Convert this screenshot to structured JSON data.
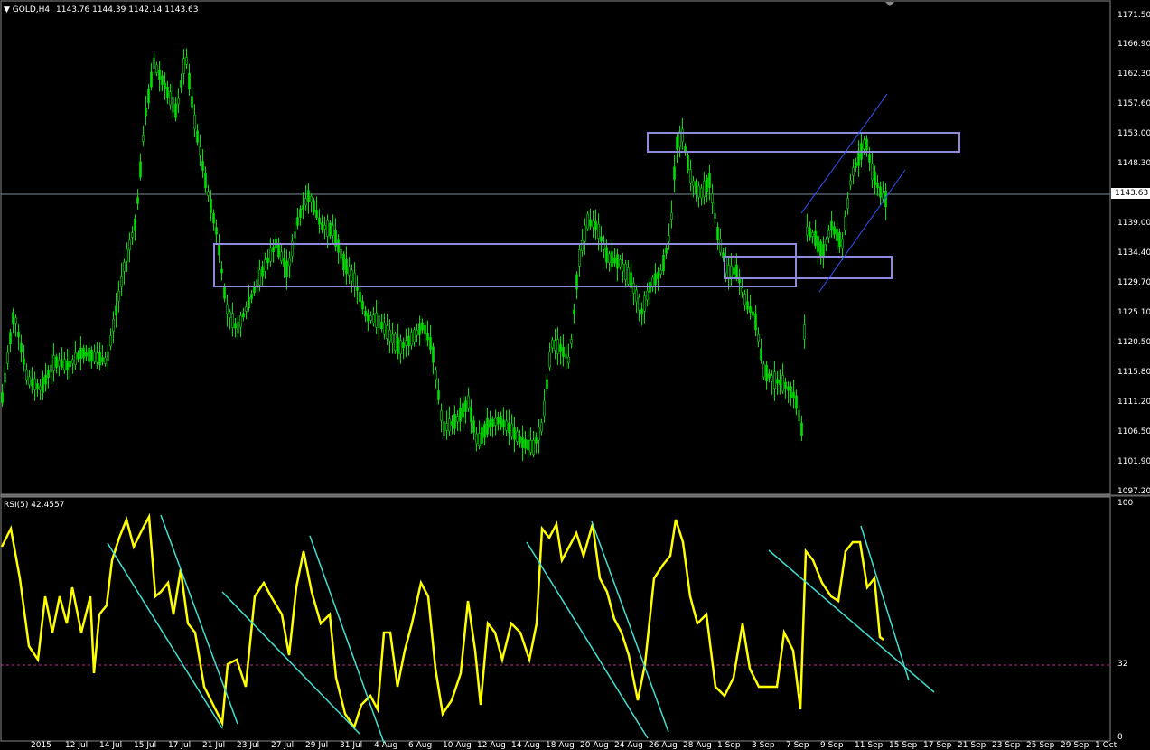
{
  "main": {
    "title": "GOLD,H4",
    "ohlc": "1143.76 1144.39 1142.14 1143.63",
    "price_scale": [
      "1171.50",
      "1166.90",
      "1162.30",
      "1157.60",
      "1153.00",
      "1148.30",
      "1139.00",
      "1134.40",
      "1129.70",
      "1125.10",
      "1120.50",
      "1115.80",
      "1111.20",
      "1106.50",
      "1101.90",
      "1097.20"
    ],
    "current_price": "1143.63"
  },
  "indicator": {
    "title": "RSI(5)",
    "value": "42.4557",
    "scale": [
      "100",
      "32",
      "0"
    ]
  },
  "x_axis": {
    "labels": [
      "2015",
      "12 Jul",
      "14 Jul",
      "15 Jul",
      "17 Jul",
      "21 Jul",
      "23 Jul",
      "27 Jul",
      "29 Jul",
      "31 Jul",
      "4 Aug",
      "6 Aug",
      "10 Aug",
      "12 Aug",
      "14 Aug",
      "18 Aug",
      "20 Aug",
      "24 Aug",
      "26 Aug",
      "28 Aug",
      "1 Sep",
      "3 Sep",
      "7 Sep",
      "9 Sep",
      "11 Sep",
      "15 Sep",
      "17 Sep",
      "21 Sep",
      "23 Sep",
      "25 Sep",
      "29 Sep",
      "1 Oct"
    ]
  },
  "colors": {
    "candle": "#00e000",
    "rsi": "#ffff00",
    "trendline": "#40e0d0",
    "box": "#8c8cd8",
    "channel": "#3050ff",
    "level32": "#b03080"
  }
}
